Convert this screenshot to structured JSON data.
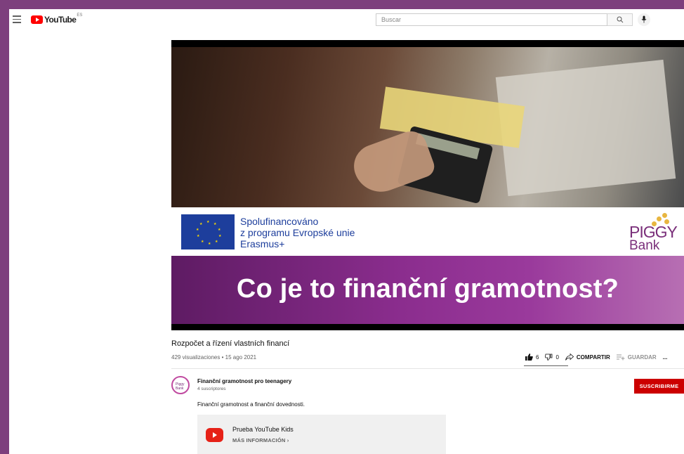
{
  "header": {
    "logo_text": "YouTube",
    "country_code": "ES",
    "search_placeholder": "Buscar"
  },
  "video": {
    "eu_text_line1": "Spolufinancováno",
    "eu_text_line2": "z programu Evropské unie",
    "eu_text_line3": "Erasmus+",
    "brand_top": "PIGGY",
    "brand_bottom": "Bank",
    "overlay_title": "Co je to finanční gramotnost?"
  },
  "meta": {
    "title": "Rozpočet a řízení vlastních financí",
    "views_date": "429 visualizaciones • 15 ago 2021",
    "likes": "6",
    "dislikes": "0",
    "share_label": "COMPARTIR",
    "save_label": "GUARDAR",
    "more_label": "..."
  },
  "channel": {
    "name": "Finanční gramotnost pro teenagery",
    "subscribers": "4 suscriptores",
    "subscribe_label": "SUSCRIBIRME",
    "avatar_text": "Piggy Bank",
    "description": "Finanční gramotnost a finanční dovednosti."
  },
  "kids_card": {
    "title": "Prueba YouTube Kids",
    "link_label": "MÁS INFORMACIÓN"
  },
  "colors": {
    "background_frame": "#7d3f7d",
    "youtube_red": "#ff0000",
    "subscribe_red": "#cc0000",
    "banner_purple": "#8b2d8e",
    "eu_blue": "#1d3e9c"
  }
}
